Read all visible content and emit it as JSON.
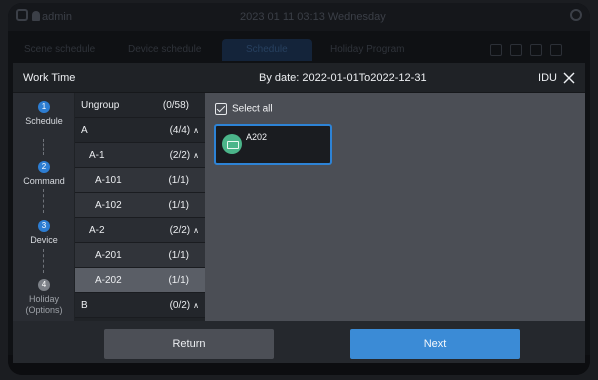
{
  "background": {
    "user": "admin",
    "datetime": "2023 01 11 03:13 Wednesday",
    "tabs": [
      "Scene schedule",
      "Device schedule",
      "Schedule",
      "Holiday Program"
    ]
  },
  "modal": {
    "title": "Work Time",
    "by_date": "By date: 2022-01-01To2022-12-31",
    "idu_label": "IDU",
    "close_icon": "close-icon"
  },
  "steps": [
    {
      "num": "1",
      "label": "Schedule",
      "active": true
    },
    {
      "num": "2",
      "label": "Command",
      "active": true
    },
    {
      "num": "3",
      "label": "Device",
      "active": true
    },
    {
      "num": "4",
      "label": "Holiday (Options)",
      "active": false
    }
  ],
  "tree": [
    {
      "name": "Ungroup",
      "count": "(0/58)",
      "level": 0,
      "expanded": false,
      "expandable": false,
      "selected": false
    },
    {
      "name": "A",
      "count": "(4/4)",
      "level": 0,
      "expanded": true,
      "expandable": true,
      "selected": false
    },
    {
      "name": "A-1",
      "count": "(2/2)",
      "level": 1,
      "expanded": true,
      "expandable": true,
      "selected": false
    },
    {
      "name": "A-101",
      "count": "(1/1)",
      "level": 2,
      "expanded": false,
      "expandable": false,
      "selected": false
    },
    {
      "name": "A-102",
      "count": "(1/1)",
      "level": 2,
      "expanded": false,
      "expandable": false,
      "selected": false
    },
    {
      "name": "A-2",
      "count": "(2/2)",
      "level": 1,
      "expanded": true,
      "expandable": true,
      "selected": false
    },
    {
      "name": "A-201",
      "count": "(1/1)",
      "level": 2,
      "expanded": false,
      "expandable": false,
      "selected": false
    },
    {
      "name": "A-202",
      "count": "(1/1)",
      "level": 2,
      "expanded": false,
      "expandable": false,
      "selected": true
    },
    {
      "name": "B",
      "count": "(0/2)",
      "level": 0,
      "expanded": true,
      "expandable": true,
      "selected": false
    }
  ],
  "content": {
    "select_all_label": "Select all",
    "select_all_checked": true,
    "devices": [
      {
        "label": "A202",
        "icon": "indoor-unit-icon",
        "selected": true
      }
    ]
  },
  "footer": {
    "return_label": "Return",
    "next_label": "Next"
  },
  "colors": {
    "accent": "#3b8bd6",
    "step_active": "#2d7dd2",
    "card_border": "#2d83d6",
    "device_icon": "#4bb58a"
  }
}
